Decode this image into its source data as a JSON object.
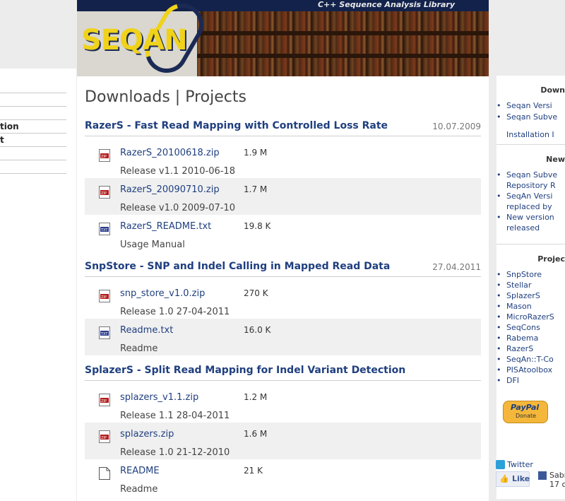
{
  "header": {
    "tagline": "C++ Sequence Analysis Library",
    "logo": "SEQAN"
  },
  "left_nav": {
    "items": [
      "",
      "",
      "tion",
      "t",
      "",
      ""
    ]
  },
  "main": {
    "title": "Downloads | Projects",
    "projects": [
      {
        "title": "RazerS - Fast Read Mapping with Controlled Loss Rate",
        "date": "10.07.2009",
        "files": [
          {
            "name": "RazerS_20100618.zip",
            "size": "1.9 M",
            "desc": "Release v1.1 2010-06-18",
            "icon": "zip-icon"
          },
          {
            "name": "RazerS_20090710.zip",
            "size": "1.7 M",
            "desc": "Release v1.0 2009-07-10",
            "icon": "zip-icon"
          },
          {
            "name": "RazerS_README.txt",
            "size": "19.8 K",
            "desc": "Usage Manual",
            "icon": "txt-icon"
          }
        ]
      },
      {
        "title": "SnpStore - SNP and Indel Calling in Mapped Read Data",
        "date": "27.04.2011",
        "files": [
          {
            "name": "snp_store_v1.0.zip",
            "size": "270 K",
            "desc": "Release 1.0 27-04-2011",
            "icon": "zip-icon"
          },
          {
            "name": "Readme.txt",
            "size": "16.0 K",
            "desc": "Readme",
            "icon": "txt-icon"
          }
        ]
      },
      {
        "title": "SplazerS - Split Read Mapping for Indel Variant Detection",
        "date": "",
        "files": [
          {
            "name": "splazers_v1.1.zip",
            "size": "1.2 M",
            "desc": "Release 1.1 28-04-2011",
            "icon": "zip-icon"
          },
          {
            "name": "splazers.zip",
            "size": "1.6 M",
            "desc": "Release 1.0 21-12-2010",
            "icon": "zip-icon"
          },
          {
            "name": "README",
            "size": "21 K",
            "desc": "Readme",
            "icon": "file-icon"
          }
        ]
      }
    ]
  },
  "right": {
    "downloads": {
      "heading": "Down",
      "items": [
        "Seqan Versi",
        "Seqan Subve"
      ],
      "extra": "Installation I"
    },
    "news": {
      "heading": "New",
      "items": [
        "Seqan Subve",
        "Repository R",
        "SeqAn Versi",
        "replaced by",
        "New version",
        "released"
      ]
    },
    "projects": {
      "heading": "Projec",
      "items": [
        "SnpStore",
        "Stellar",
        "SplazerS",
        "Mason",
        "MicroRazerS",
        "SeqCons",
        "Rabema",
        "RazerS",
        "SeqAn::T-Co",
        "PISAtoolbox",
        "DFI"
      ]
    },
    "paypal": {
      "brand": "PayPal",
      "label": "Donate"
    },
    "twitter": "Twitter",
    "like": "Like",
    "facebook": [
      "Sabri",
      "17 c"
    ]
  }
}
